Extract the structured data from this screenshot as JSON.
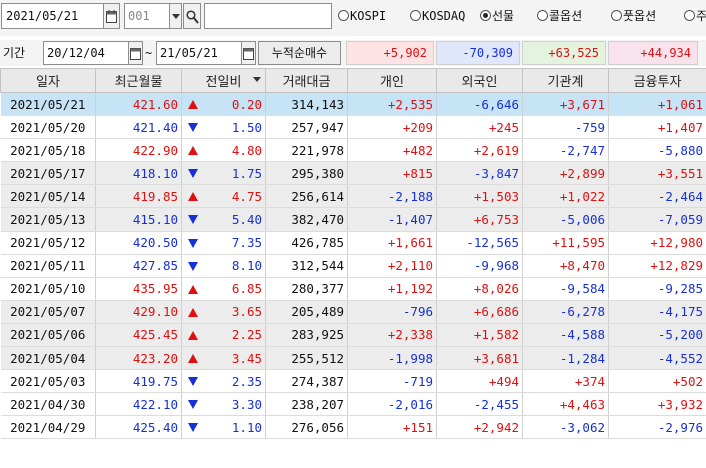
{
  "toolbar": {
    "date": "2021/05/21",
    "code_value": "001",
    "code_placeholder": "001",
    "name_value": "",
    "radios": [
      {
        "label": "KOSPI",
        "checked": false
      },
      {
        "label": "KOSDAQ",
        "checked": false
      },
      {
        "label": "선물",
        "checked": true
      },
      {
        "label": "콜옵션",
        "checked": false
      },
      {
        "label": "풋옵션",
        "checked": false
      },
      {
        "label": "주",
        "checked": false
      }
    ]
  },
  "period": {
    "label": "기간",
    "from": "20/12/04",
    "tilde": "~",
    "to": "21/05/21",
    "cum_button": "누적순매수",
    "sums": {
      "individual": "+5,902",
      "foreign": "-70,309",
      "institution": "+63,525",
      "finance": "+44,934"
    }
  },
  "colors": {
    "up": "#e01010",
    "down": "#1530d8",
    "selected_row": "#c7e3f6",
    "alt_row": "#ececec",
    "sum_individual_bg": "#fde3e3",
    "sum_foreign_bg": "#e1e7fb",
    "sum_institution_bg": "#e4f3de",
    "sum_finance_bg": "#f8e3ec"
  },
  "table": {
    "headers": {
      "date": "일자",
      "price": "최근월물",
      "change": "전일비",
      "amount": "거래대금",
      "individual": "개인",
      "foreign": "외국인",
      "institution": "기관계",
      "finance": "금융투자"
    },
    "rows": [
      {
        "date": "2021/05/21",
        "price": "421.60",
        "dir": "up",
        "change": "0.20",
        "amount": "314,143",
        "individual": "+2,535",
        "foreign": "-6,646",
        "institution": "+3,671",
        "finance": "+1,061"
      },
      {
        "date": "2021/05/20",
        "price": "421.40",
        "dir": "down",
        "change": "1.50",
        "amount": "257,947",
        "individual": "+209",
        "foreign": "+245",
        "institution": "-759",
        "finance": "+1,407"
      },
      {
        "date": "2021/05/18",
        "price": "422.90",
        "dir": "up",
        "change": "4.80",
        "amount": "221,978",
        "individual": "+482",
        "foreign": "+2,619",
        "institution": "-2,747",
        "finance": "-5,880"
      },
      {
        "date": "2021/05/17",
        "price": "418.10",
        "dir": "down",
        "change": "1.75",
        "amount": "295,380",
        "individual": "+815",
        "foreign": "-3,847",
        "institution": "+2,899",
        "finance": "+3,551"
      },
      {
        "date": "2021/05/14",
        "price": "419.85",
        "dir": "up",
        "change": "4.75",
        "amount": "256,614",
        "individual": "-2,188",
        "foreign": "+1,503",
        "institution": "+1,022",
        "finance": "-2,464"
      },
      {
        "date": "2021/05/13",
        "price": "415.10",
        "dir": "down",
        "change": "5.40",
        "amount": "382,470",
        "individual": "-1,407",
        "foreign": "+6,753",
        "institution": "-5,006",
        "finance": "-7,059"
      },
      {
        "date": "2021/05/12",
        "price": "420.50",
        "dir": "down",
        "change": "7.35",
        "amount": "426,785",
        "individual": "+1,661",
        "foreign": "-12,565",
        "institution": "+11,595",
        "finance": "+12,980"
      },
      {
        "date": "2021/05/11",
        "price": "427.85",
        "dir": "down",
        "change": "8.10",
        "amount": "312,544",
        "individual": "+2,110",
        "foreign": "-9,968",
        "institution": "+8,470",
        "finance": "+12,829"
      },
      {
        "date": "2021/05/10",
        "price": "435.95",
        "dir": "up",
        "change": "6.85",
        "amount": "280,377",
        "individual": "+1,192",
        "foreign": "+8,026",
        "institution": "-9,584",
        "finance": "-9,285"
      },
      {
        "date": "2021/05/07",
        "price": "429.10",
        "dir": "up",
        "change": "3.65",
        "amount": "205,489",
        "individual": "-796",
        "foreign": "+6,686",
        "institution": "-6,278",
        "finance": "-4,175"
      },
      {
        "date": "2021/05/06",
        "price": "425.45",
        "dir": "up",
        "change": "2.25",
        "amount": "283,925",
        "individual": "+2,338",
        "foreign": "+1,582",
        "institution": "-4,588",
        "finance": "-5,200"
      },
      {
        "date": "2021/05/04",
        "price": "423.20",
        "dir": "up",
        "change": "3.45",
        "amount": "255,512",
        "individual": "-1,998",
        "foreign": "+3,681",
        "institution": "-1,284",
        "finance": "-4,552"
      },
      {
        "date": "2021/05/03",
        "price": "419.75",
        "dir": "down",
        "change": "2.35",
        "amount": "274,387",
        "individual": "-719",
        "foreign": "+494",
        "institution": "+374",
        "finance": "+502"
      },
      {
        "date": "2021/04/30",
        "price": "422.10",
        "dir": "down",
        "change": "3.30",
        "amount": "238,207",
        "individual": "-2,016",
        "foreign": "-2,455",
        "institution": "+4,463",
        "finance": "+3,932"
      },
      {
        "date": "2021/04/29",
        "price": "425.40",
        "dir": "down",
        "change": "1.10",
        "amount": "276,056",
        "individual": "+151",
        "foreign": "+2,942",
        "institution": "-3,062",
        "finance": "-2,976"
      }
    ]
  }
}
